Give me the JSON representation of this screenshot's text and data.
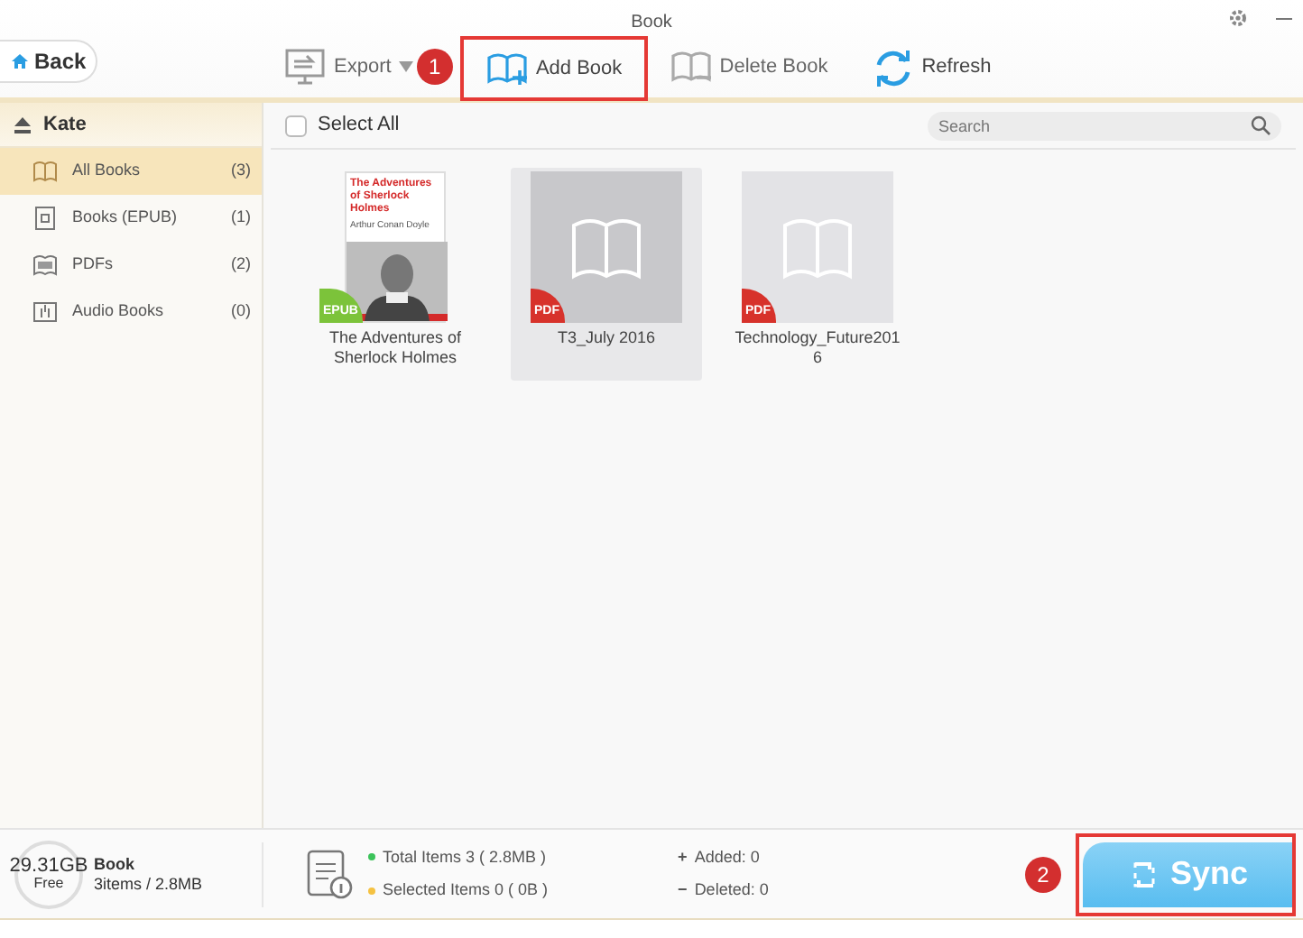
{
  "window": {
    "title": "Book"
  },
  "back_button": {
    "label": "Back"
  },
  "toolbar": [
    {
      "kind": "export",
      "label": "Export",
      "disabled": true
    },
    {
      "kind": "add",
      "label": "Add Book",
      "disabled": false,
      "step": "1"
    },
    {
      "kind": "delete",
      "label": "Delete Book",
      "disabled": true
    },
    {
      "kind": "refresh",
      "label": "Refresh",
      "disabled": false
    }
  ],
  "sidebar": {
    "device": "Kate",
    "items": [
      {
        "kind": "book",
        "label": "All Books",
        "count": "(3)",
        "selected": true
      },
      {
        "kind": "epub",
        "label": "Books (EPUB)",
        "count": "(1)",
        "selected": false
      },
      {
        "kind": "pdf",
        "label": "PDFs",
        "count": "(2)",
        "selected": false
      },
      {
        "kind": "audio",
        "label": "Audio Books",
        "count": "(0)",
        "selected": false
      }
    ]
  },
  "select_all": {
    "label": "Select All",
    "checked": false
  },
  "search": {
    "placeholder": "Search"
  },
  "books": [
    {
      "title": "The Adventures of Sherlock Holmes",
      "format": "EPUB",
      "selected": false,
      "cover": {
        "kind": "picture",
        "cover_title": "The Adventures of Sherlock Holmes",
        "cover_author": "Arthur Conan Doyle"
      }
    },
    {
      "title": "T3_July 2016",
      "format": "PDF",
      "selected": true,
      "cover": {
        "kind": "placeholder"
      }
    },
    {
      "title": "Technology_Future2016",
      "format": "PDF",
      "selected": false,
      "cover": {
        "kind": "placeholder"
      }
    }
  ],
  "storage": {
    "free": "29.31GB",
    "free_label": "Free",
    "name": "Book",
    "summary": "3items / 2.8MB"
  },
  "stats": [
    {
      "label": "Total Items 3 ( 2.8MB )",
      "color": "#3cc35a"
    },
    {
      "label": "Selected Items 0 ( 0B )",
      "color": "#f5c242"
    }
  ],
  "changes": [
    {
      "sign": "+",
      "label": "Added: 0"
    },
    {
      "sign": "−",
      "label": "Deleted: 0"
    }
  ],
  "sync_button": {
    "label": "Sync",
    "step": "2"
  }
}
